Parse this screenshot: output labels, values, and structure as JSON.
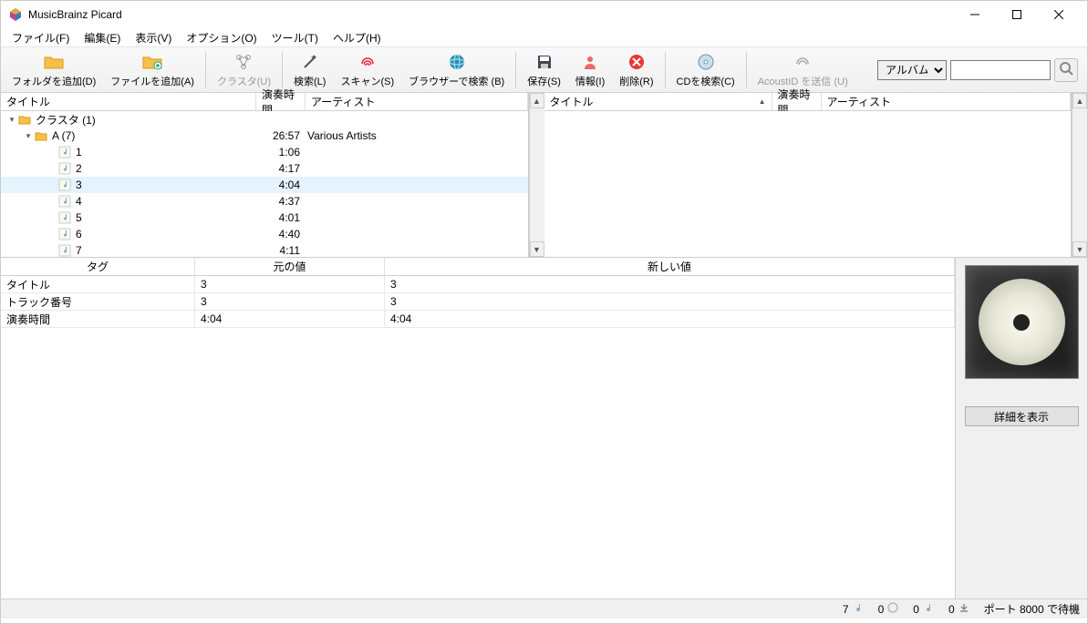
{
  "window": {
    "title": "MusicBrainz Picard"
  },
  "menu": {
    "file": "ファイル(F)",
    "edit": "編集(E)",
    "view": "表示(V)",
    "options": "オプション(O)",
    "tools": "ツール(T)",
    "help": "ヘルプ(H)"
  },
  "toolbar": {
    "add_folder": "フォルダを追加(D)",
    "add_files": "ファイルを追加(A)",
    "cluster": "クラスタ(U)",
    "lookup": "検索(L)",
    "scan": "スキャン(S)",
    "browser_lookup": "ブラウザーで検索 (B)",
    "save": "保存(S)",
    "info": "情報(I)",
    "remove": "削除(R)",
    "cd_lookup": "CDを検索(C)",
    "submit_acoustid": "AcoustID を送信 (U)"
  },
  "search": {
    "type": "アルバム",
    "query": ""
  },
  "columns": {
    "title": "タイトル",
    "length": "演奏時間",
    "artist": "アーティスト"
  },
  "left_tree": {
    "cluster_label": "クラスタ (1)",
    "album": {
      "label": "A (7)",
      "length": "26:57",
      "artist": "Various Artists"
    },
    "tracks": [
      {
        "n": "1",
        "len": "1:06"
      },
      {
        "n": "2",
        "len": "4:17"
      },
      {
        "n": "3",
        "len": "4:04",
        "selected": true
      },
      {
        "n": "4",
        "len": "4:37"
      },
      {
        "n": "5",
        "len": "4:01"
      },
      {
        "n": "6",
        "len": "4:40"
      },
      {
        "n": "7",
        "len": "4:11"
      }
    ]
  },
  "tags": {
    "headers": {
      "tag": "タグ",
      "original": "元の値",
      "new": "新しい値"
    },
    "rows": [
      {
        "tag": "タイトル",
        "orig": "3",
        "new": "3"
      },
      {
        "tag": "トラック番号",
        "orig": "3",
        "new": "3"
      },
      {
        "tag": "演奏時間",
        "orig": "4:04",
        "new": "4:04"
      }
    ]
  },
  "cover": {
    "details_btn": "詳細を表示"
  },
  "status": {
    "files": "7",
    "pending1": "0",
    "pending2": "0",
    "queue": "0",
    "listen": "ポート 8000 で待機"
  }
}
